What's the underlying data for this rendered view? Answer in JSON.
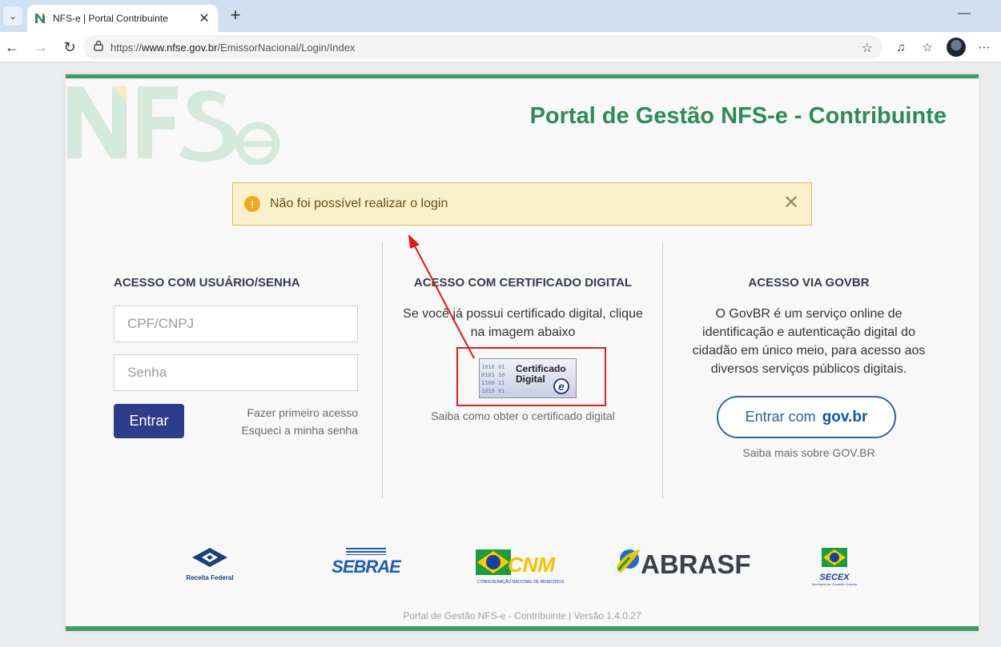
{
  "browser": {
    "tab_title": "NFS-e | Portal Contribuinte",
    "url_prefix": "https://",
    "url_host": "www.nfse.gov.br",
    "url_path": "/EmissorNacional/Login/Index"
  },
  "header": {
    "title": "Portal de Gestão NFS-e - Contribuinte"
  },
  "alert": {
    "message": "Não foi possível realizar o login"
  },
  "login_user": {
    "title": "ACESSO COM USUÁRIO/SENHA",
    "cpf_placeholder": "CPF/CNPJ",
    "password_placeholder": "Senha",
    "submit_label": "Entrar",
    "first_access_link": "Fazer primeiro acesso",
    "forgot_password_link": "Esqueci a minha senha"
  },
  "login_cert": {
    "title": "ACESSO COM CERTIFICADO DIGITAL",
    "description_line1": "Se você já possui certificado digital, clique",
    "description_line2": "na imagem abaixo",
    "cert_image_line1": "Certificado",
    "cert_image_line2": "Digital",
    "help_link": "Saiba como obter o certificado digital"
  },
  "login_govbr": {
    "title": "ACESSO VIA GOVBR",
    "description": [
      "O GovBR é um serviço online de",
      "identificação e autenticação digital do",
      "cidadão em único meio, para acesso aos",
      "diversos serviços públicos digitais."
    ],
    "button_label": "Entrar com",
    "button_brand": "gov.br",
    "help_link": "Saiba mais sobre GOV.BR"
  },
  "partners": {
    "receita": "Receita Federal",
    "sebrae": "SEBRAE",
    "cnm": "CNM",
    "cnm_sub": "CONFEDERAÇÃO NACIONAL DE MUNICÍPIOS",
    "abrasf": "ABRASF",
    "secex": "SECEX",
    "secex_sub": "Secretaria de Comércio Exterior"
  },
  "footer": {
    "version_text": "Portal de Gestão NFS-e - Contribuinte | Versão 1.4.0.27"
  },
  "colors": {
    "brand_green": "#2e8b57",
    "primary_button": "#2e3d8a",
    "alert_bg": "#faf0cc",
    "annotation_red": "#d92020"
  }
}
